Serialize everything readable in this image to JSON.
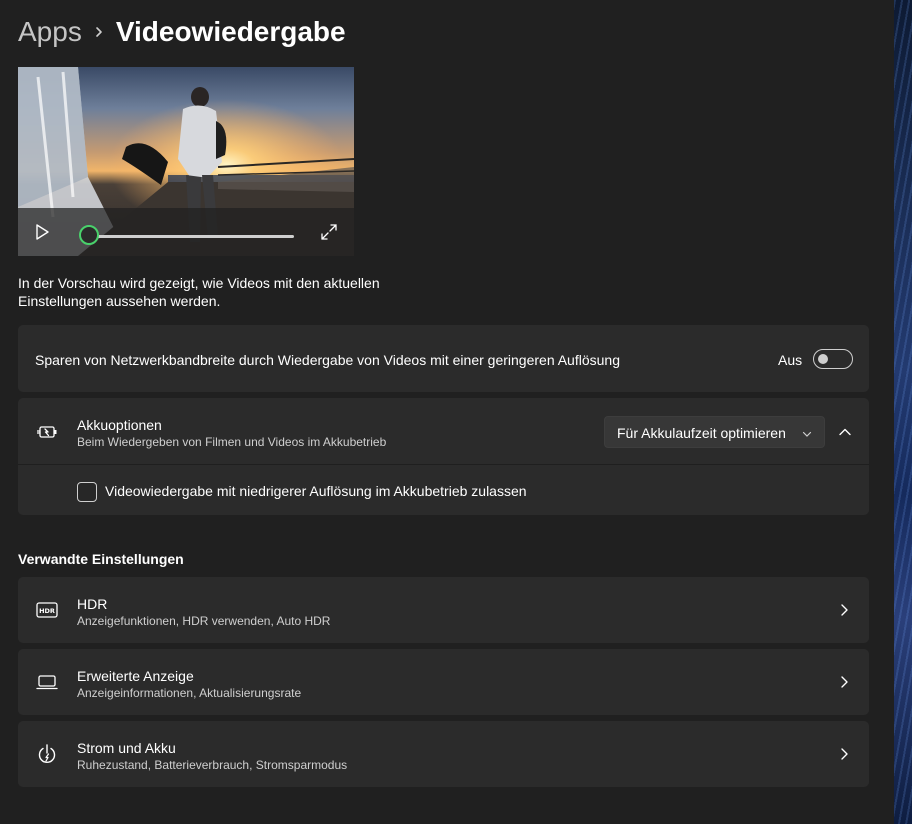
{
  "breadcrumb": {
    "parent": "Apps",
    "current": "Videowiedergabe"
  },
  "video_preview": {
    "progress": 0.0,
    "description": "In der Vorschau wird gezeigt, wie Videos mit den aktuellen Einstellungen aussehen werden."
  },
  "bandwidth_card": {
    "label": "Sparen von Netzwerkbandbreite durch Wiedergabe von Videos mit einer geringeren Auflösung",
    "toggle_state": "Aus",
    "toggle_on": false
  },
  "battery_card": {
    "icon": "battery-charging-icon",
    "title": "Akkuoptionen",
    "subtitle": "Beim Wiedergeben von Filmen und Videos im Akkubetrieb",
    "dropdown_value": "Für Akkulaufzeit optimieren",
    "expanded": true,
    "checkbox_label": "Videowiedergabe mit niedrigerer Auflösung im Akkubetrieb zulassen",
    "checkbox_checked": false
  },
  "related": {
    "heading": "Verwandte Einstellungen",
    "items": [
      {
        "icon": "hdr-icon",
        "title": "HDR",
        "subtitle": "Anzeigefunktionen, HDR verwenden, Auto HDR"
      },
      {
        "icon": "laptop-icon",
        "title": "Erweiterte Anzeige",
        "subtitle": "Anzeigeinformationen, Aktualisierungsrate"
      },
      {
        "icon": "power-icon",
        "title": "Strom und Akku",
        "subtitle": "Ruhezustand, Batterieverbrauch, Stromsparmodus"
      }
    ]
  },
  "colors": {
    "background": "#202020",
    "card": "#2b2b2b",
    "accent_seek": "#49d16b",
    "text": "#ffffff",
    "subtext": "#cfcfcf"
  }
}
